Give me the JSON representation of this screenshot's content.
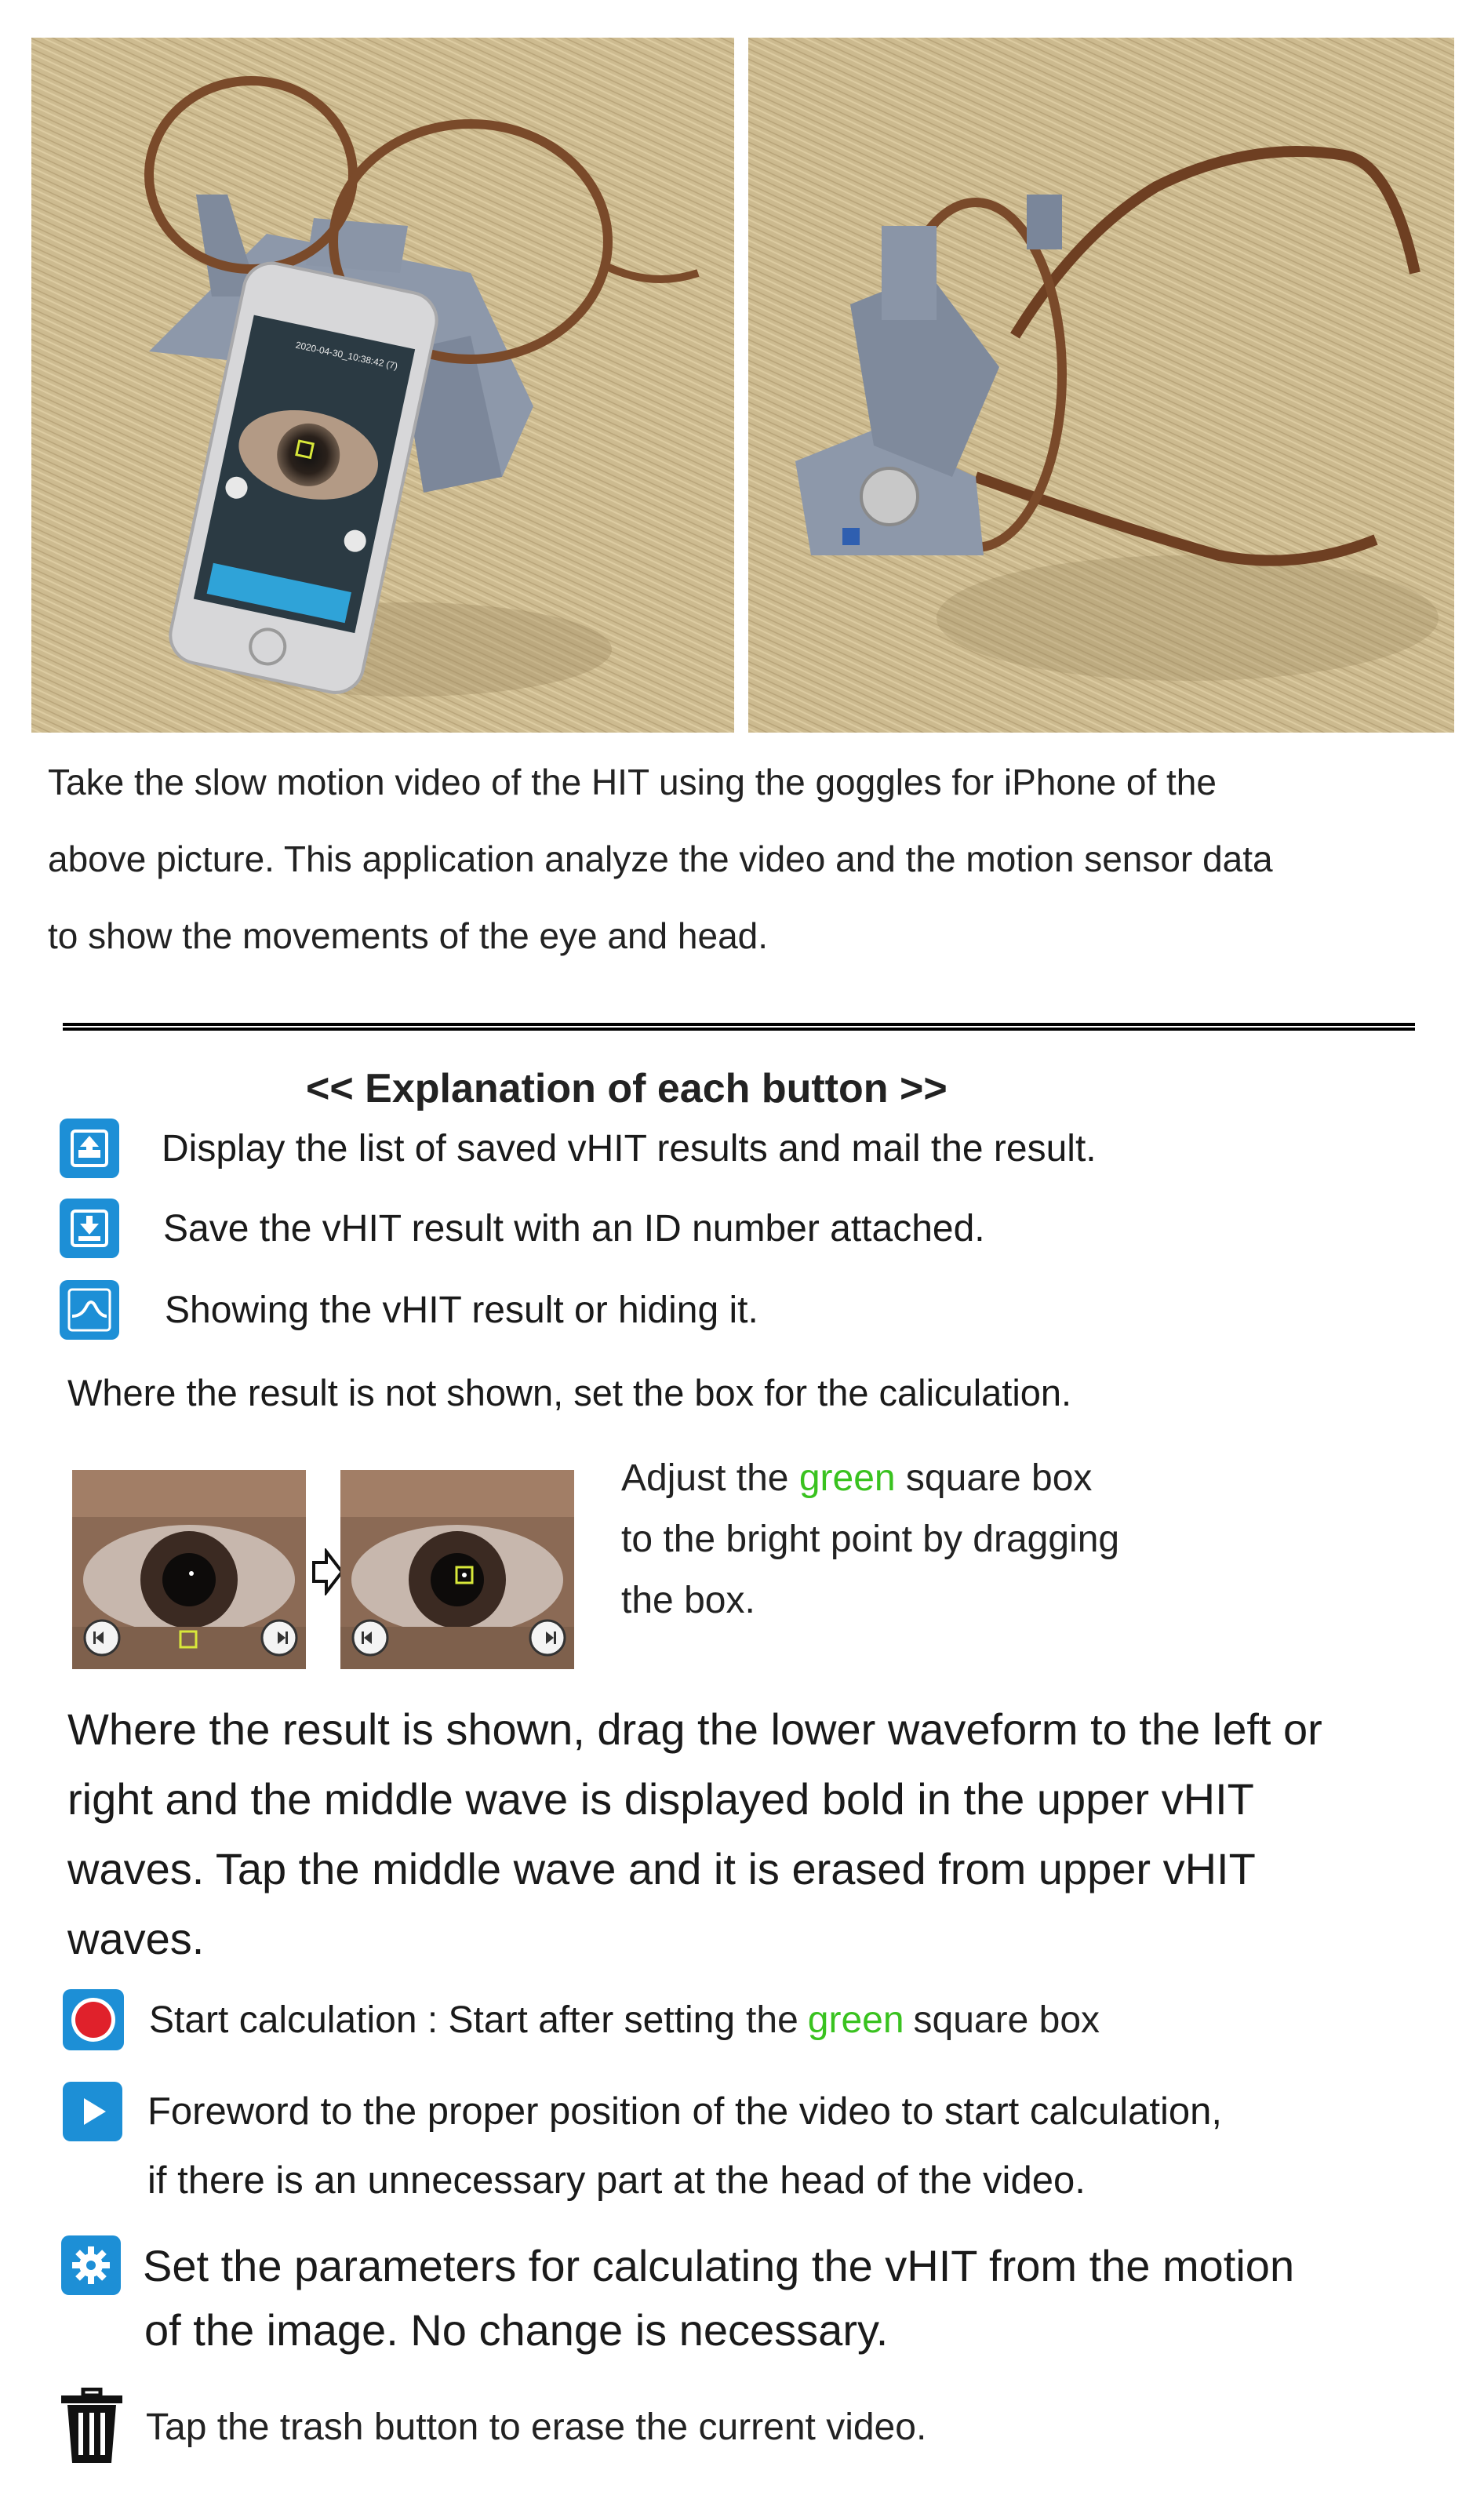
{
  "intro": {
    "line1": "Take the slow motion video of the HIT using the goggles for iPhone of the",
    "line2": "above picture. This application analyze the video and the motion sensor data",
    "line3": "to show the movements of the eye and head."
  },
  "heading": "<< Explanation of each button >>",
  "buttons": [
    {
      "icon": "upload-icon",
      "text": "Display the list of saved vHIT results and mail the result."
    },
    {
      "icon": "download-icon",
      "text": "Save the vHIT result with an ID number attached."
    },
    {
      "icon": "wave-icon",
      "text": "Showing the vHIT result or hiding it."
    }
  ],
  "not_shown_note": "Where the result is not shown, set the box for the caliculation.",
  "adjust": {
    "line1_pre": "Adjust the",
    "green_word": "green",
    "line1_post": "square box",
    "line2": "to the bright point by dragging",
    "line3": "the box."
  },
  "shown_note": {
    "line1": "Where the result is shown, drag the lower waveform to the left or",
    "line2": "right and the middle wave is displayed bold in the upper vHIT",
    "line3": "waves. Tap the middle wave and it is erased from upper vHIT",
    "line4": "waves."
  },
  "controls": {
    "start": {
      "pre": "Start calculation : Start after setting",
      "mid": "the",
      "green": "green",
      "post": "square box"
    },
    "forward": {
      "line1": "Foreword to the proper position of the video to start calculation,",
      "line2": "if there is an  unnecessary part at the head of the video."
    },
    "settings": {
      "line1": "Set the parameters for calculating the vHIT from the motion",
      "line2": "of the image. No change is necessary."
    },
    "trash": "Tap the trash button to erase the current video."
  },
  "phone_screen_text": "2020-04-30_10:38:42 (7)",
  "colors": {
    "icon_blue": "#1d8fd6",
    "record_red": "#e0212b",
    "green_text": "#39c21f",
    "frame_grey": "#8d98aa",
    "glasses_brown": "#7a4a2a",
    "tatami": "#cbb98e"
  }
}
